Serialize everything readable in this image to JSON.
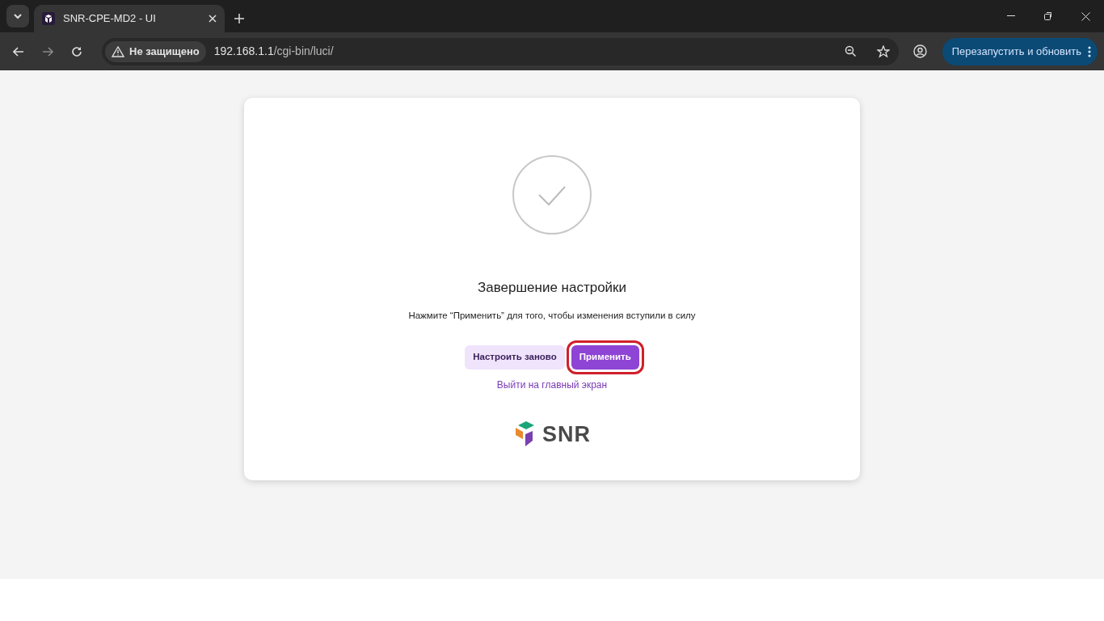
{
  "browser": {
    "tab": {
      "title": "SNR-CPE-MD2 - UI",
      "selected": true
    },
    "security_label": "Не защищено",
    "url_host": "192.168.1.1",
    "url_path": "/cgi-bin/luci/",
    "update_button": "Перезапустить и обновить"
  },
  "dialog": {
    "title": "Завершение настройки",
    "message": "Нажмите “Применить” для того, чтобы изменения вступили в силу",
    "buttons": [
      {
        "label": "Настроить заново",
        "kind": "secondary",
        "highlighted": false
      },
      {
        "label": "Применить",
        "kind": "primary",
        "highlighted": true
      }
    ],
    "link": "Выйти на главный экран",
    "logo_text": "SNR"
  }
}
